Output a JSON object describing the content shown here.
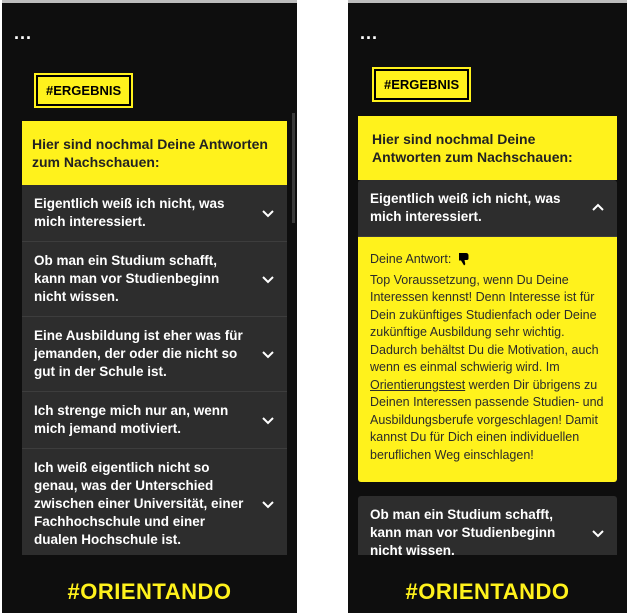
{
  "colors": {
    "accent": "#fff21c",
    "background": "#0e0e0e",
    "card": "#2d2d2d"
  },
  "menu": {
    "icon": "more-dots-icon",
    "label": "..."
  },
  "tag": "#ERGEBNIS",
  "intro": "Hier sind nochmal Deine Antworten zum Nachschauen:",
  "brand": "#ORIENTANDO",
  "questions": [
    "Eigentlich weiß ich nicht, was mich interessiert.",
    "Ob man ein Studium schafft, kann man vor Studienbeginn nicht wissen.",
    "Eine Ausbildung ist eher was für jemanden, der oder die nicht so gut in der Schule ist.",
    "Ich strenge mich nur an, wenn mich jemand motiviert.",
    "Ich weiß eigentlich nicht so genau, was der Unterschied zwischen einer Universität, einer Fachhochschule und einer dualen Hochschule ist."
  ],
  "answer": {
    "label": "Deine Antwort:",
    "icon": "thumbs-down-icon",
    "text_before_link": "Top Voraussetzung, wenn Du Deine Interessen kennst! Denn Interesse ist für Dein zukünftiges Studienfach oder Deine zukünftige Ausbildung sehr wichtig. Dadurch behältst Du die Motivation, auch wenn es einmal schwierig wird. Im ",
    "link": "Orientierungstest",
    "text_after_link": " werden Dir übrigens zu Deinen Interessen passende Studien- und Ausbildungsberufe vorgeschlagen! Damit kannst Du für Dich einen individuellen beruflichen Weg einschlagen!"
  }
}
